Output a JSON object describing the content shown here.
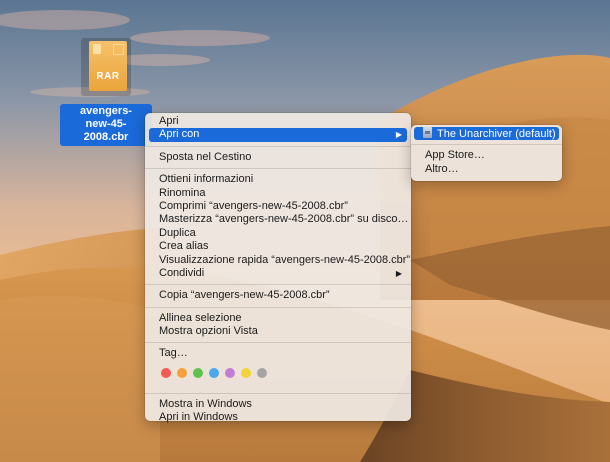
{
  "file": {
    "badge": "RAR",
    "name_line1": "avengers-",
    "name_line2": "new-45-2008.cbr"
  },
  "menu": {
    "group1": [
      "Apri",
      "Apri con"
    ],
    "group2": [
      "Sposta nel Cestino"
    ],
    "group3": [
      "Ottieni informazioni",
      "Rinomina",
      "Comprimi “avengers-new-45-2008.cbr”",
      "Masterizza “avengers-new-45-2008.cbr” su disco…",
      "Duplica",
      "Crea alias",
      "Visualizzazione rapida “avengers-new-45-2008.cbr”",
      "Condividi"
    ],
    "group4": [
      "Copia “avengers-new-45-2008.cbr”"
    ],
    "group5": [
      "Allinea selezione",
      "Mostra opzioni Vista"
    ],
    "tags_label": "Tag…",
    "tag_colors": [
      "#f25a52",
      "#f5a03c",
      "#5ec34d",
      "#4aa7ee",
      "#c27ed3",
      "#f4d33a",
      "#a5a5a5"
    ],
    "group7": [
      "Mostra in Windows",
      "Apri in Windows"
    ]
  },
  "submenu": {
    "default_app": "The Unarchiver (default)",
    "items": [
      "App Store…",
      "Altro…"
    ]
  },
  "colors": {
    "selection": "#1a6ad9",
    "sky_top": "#5d7895",
    "sky_bottom": "#e8b589",
    "dune": "#c98a48"
  }
}
